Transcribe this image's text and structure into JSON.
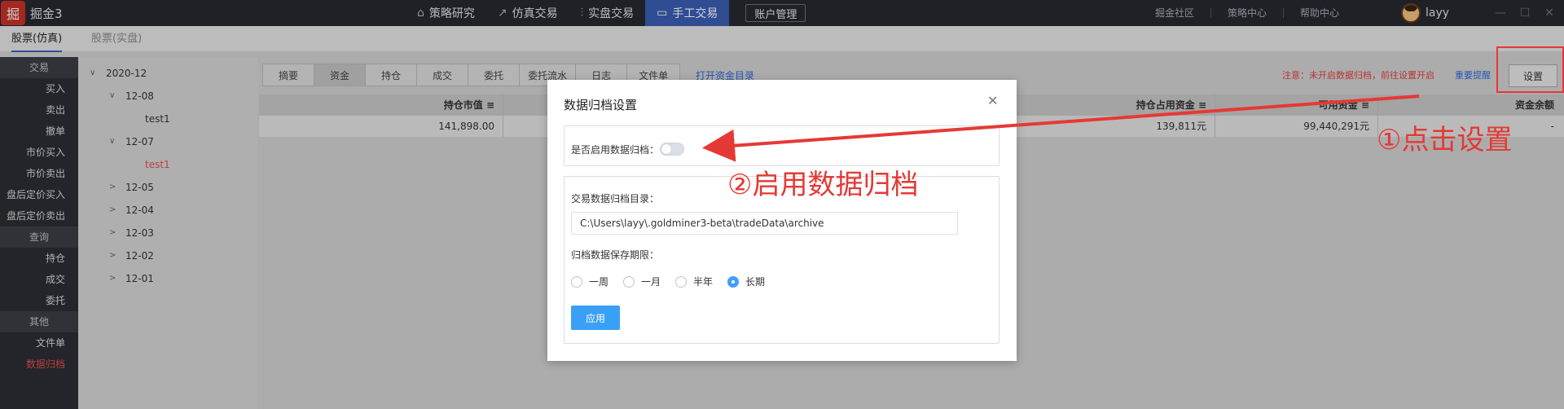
{
  "app": {
    "logo_glyph": "掘",
    "name": "掘金3"
  },
  "topnav": [
    {
      "label": "策略研究",
      "icon": "graduation-cap-icon",
      "glyph": "⌂"
    },
    {
      "label": "仿真交易",
      "icon": "line-chart-icon",
      "glyph": "↗"
    },
    {
      "label": "实盘交易",
      "icon": "bar-chart-icon",
      "glyph": "⫶"
    },
    {
      "label": "手工交易",
      "icon": "monitor-icon",
      "glyph": "▭"
    }
  ],
  "account_button": "账户管理",
  "toplinks": [
    "掘金社区",
    "策略中心",
    "帮助中心"
  ],
  "user": {
    "name": "layy"
  },
  "subtabs": [
    "股票(仿真)",
    "股票(实盘)"
  ],
  "sidebar": [
    {
      "label": "交易",
      "section": true
    },
    {
      "label": "买入"
    },
    {
      "label": "卖出"
    },
    {
      "label": "撤单"
    },
    {
      "label": "市价买入"
    },
    {
      "label": "市价卖出"
    },
    {
      "label": "盘后定价买入"
    },
    {
      "label": "盘后定价卖出"
    },
    {
      "label": "查询",
      "section": true
    },
    {
      "label": "持仓"
    },
    {
      "label": "成交"
    },
    {
      "label": "委托"
    },
    {
      "label": "其他",
      "section": true
    },
    {
      "label": "文件单"
    },
    {
      "label": "数据归档",
      "active": true
    }
  ],
  "tree": [
    {
      "label": "2020-12",
      "level": 0,
      "expanded": true
    },
    {
      "label": "12-08",
      "level": 1,
      "expanded": true
    },
    {
      "label": "test1",
      "level": 2
    },
    {
      "label": "12-07",
      "level": 1,
      "expanded": true
    },
    {
      "label": "test1",
      "level": 2,
      "active": true
    },
    {
      "label": "12-05",
      "level": 1
    },
    {
      "label": "12-04",
      "level": 1
    },
    {
      "label": "12-03",
      "level": 1
    },
    {
      "label": "12-02",
      "level": 1
    },
    {
      "label": "12-01",
      "level": 1
    }
  ],
  "toolbar_tabs": [
    {
      "label": "摘要"
    },
    {
      "label": "资金",
      "active": true
    },
    {
      "label": "持仓"
    },
    {
      "label": "成交"
    },
    {
      "label": "委托"
    },
    {
      "label": "委托流水"
    },
    {
      "label": "日志"
    },
    {
      "label": "文件单"
    }
  ],
  "open_dir_link": "打开资金目录",
  "notice": "注意：未开启数据归档，前往设置开启",
  "notice_link": "重要提醒",
  "settings_button": "设置",
  "table": {
    "columns": [
      "持仓市值 ≡",
      "持仓占用资金 ≡",
      "可用资金 ≡",
      "资金余额"
    ],
    "row": [
      "141,898.00",
      "139,811元",
      "99,440,291元",
      "-"
    ]
  },
  "modal": {
    "title": "数据归档设置",
    "enable_label": "是否启用数据归档：",
    "enable_on": false,
    "dir_label": "交易数据归档目录：",
    "dir_value": "C:\\Users\\layy\\.goldminer3-beta\\tradeData\\archive",
    "retention_label": "归档数据保存期限：",
    "retention_options": [
      "一周",
      "一月",
      "半年",
      "长期"
    ],
    "retention_selected": "长期",
    "apply_button": "应用"
  },
  "annotations": {
    "step1": "①点击设置",
    "step2": "②启用数据归档",
    "color": "#e53935"
  },
  "colors": {
    "accent": "#3b5fb5",
    "link": "#2f6bd8",
    "danger": "#e04040",
    "primary_button": "#3aa0f6"
  }
}
